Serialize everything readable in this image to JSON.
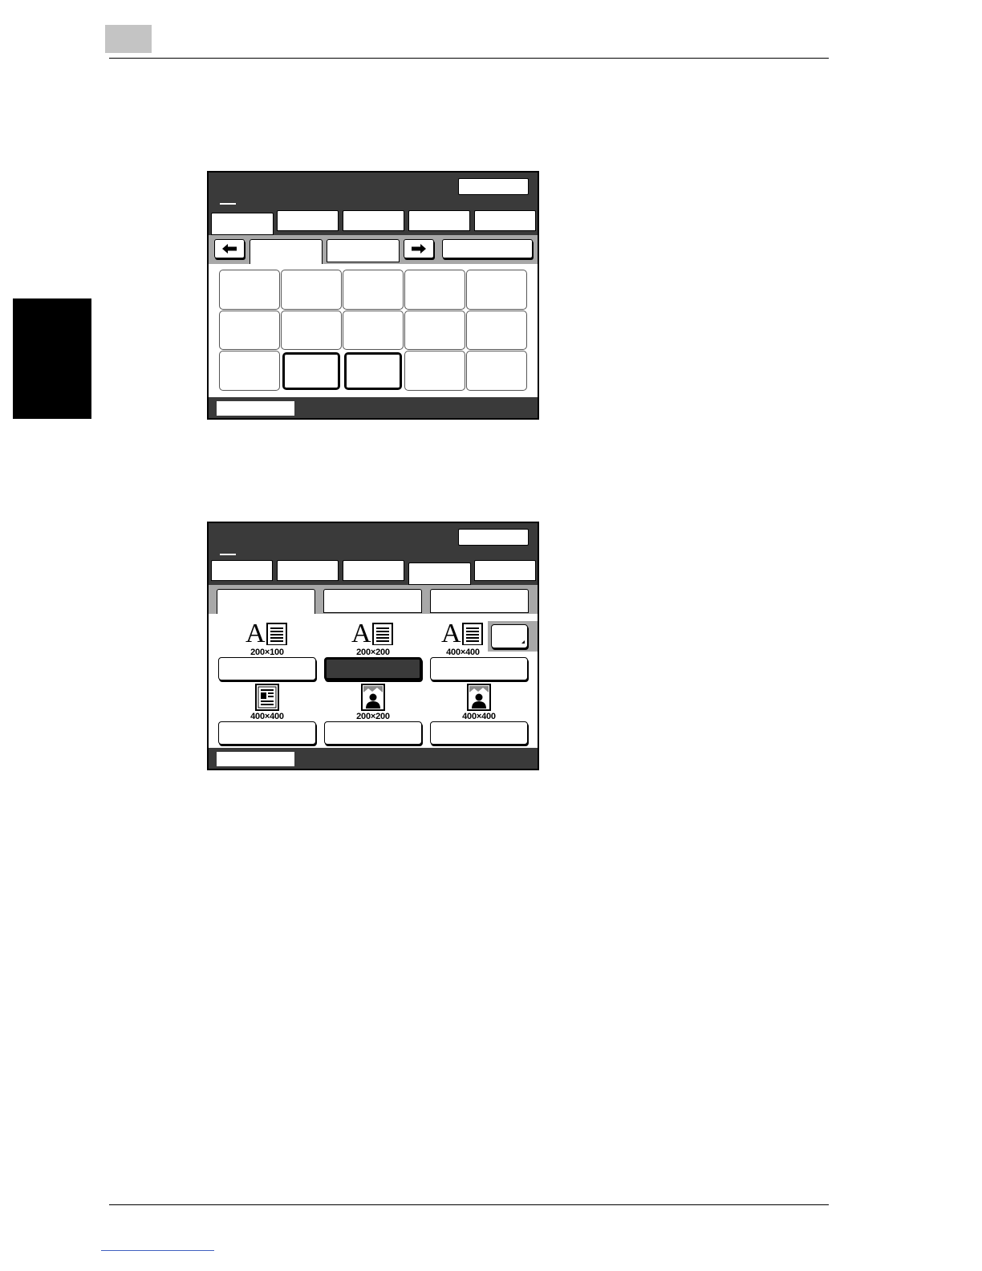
{
  "resolution_screen": {
    "options": [
      {
        "label": "200×100",
        "icon": "text-mode-icon",
        "selected": false
      },
      {
        "label": "200×200",
        "icon": "text-mode-icon",
        "selected": true
      },
      {
        "label": "400×400",
        "icon": "text-mode-icon",
        "selected": false
      },
      {
        "label": "400×400",
        "icon": "text-photo-mode-icon",
        "selected": false
      },
      {
        "label": "200×200",
        "icon": "photo-mode-icon",
        "selected": false
      },
      {
        "label": "400×400",
        "icon": "photo-mode-icon",
        "selected": false
      }
    ],
    "icon_glyph": "A"
  },
  "colors": {
    "screen_bg": "#3a3a3a",
    "band_gray": "#a8a8a8",
    "page_num_gray": "#c4c4c4"
  }
}
